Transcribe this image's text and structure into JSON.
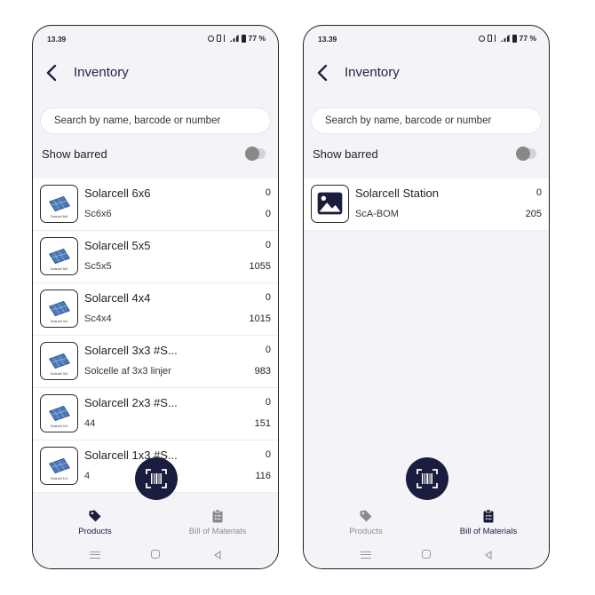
{
  "screens": [
    {
      "status": {
        "time": "13.39",
        "battery": "77 %"
      },
      "header": {
        "title": "Inventory"
      },
      "search": {
        "placeholder": "Search by name, barcode or number"
      },
      "barred": {
        "label": "Show barred",
        "enabled": false
      },
      "items": [
        {
          "name": "Solarcell 6x6",
          "sub": "Sc6x6",
          "top_value": "0",
          "bottom_value": "0",
          "thumb": "solar-panel-icon",
          "thumb_caption": "Solarcell 6x6"
        },
        {
          "name": "Solarcell 5x5",
          "sub": "Sc5x5",
          "top_value": "0",
          "bottom_value": "1055",
          "thumb": "solar-panel-icon",
          "thumb_caption": "Solarcell 5x5"
        },
        {
          "name": "Solarcell 4x4",
          "sub": "Sc4x4",
          "top_value": "0",
          "bottom_value": "1015",
          "thumb": "solar-panel-icon",
          "thumb_caption": "Solarcell 4x4"
        },
        {
          "name": "Solarcell 3x3 #S...",
          "sub": "Solcelle af 3x3 linjer",
          "top_value": "0",
          "bottom_value": "983",
          "thumb": "solar-panel-icon",
          "thumb_caption": "Solarcell 3x3"
        },
        {
          "name": "Solarcell 2x3 #S...",
          "sub": "44",
          "top_value": "0",
          "bottom_value": "151",
          "thumb": "solar-panel-icon",
          "thumb_caption": "Solarcell 2x3"
        },
        {
          "name": "Solarcell 1x3 #S...",
          "sub": "4",
          "top_value": "0",
          "bottom_value": "116",
          "thumb": "solar-panel-icon",
          "thumb_caption": "Solarcell 1x3"
        }
      ],
      "nav": {
        "products": "Products",
        "bom": "Bill of Materials",
        "active": "products"
      }
    },
    {
      "status": {
        "time": "13.39",
        "battery": "77 %"
      },
      "header": {
        "title": "Inventory"
      },
      "search": {
        "placeholder": "Search by name, barcode or number"
      },
      "barred": {
        "label": "Show barred",
        "enabled": false
      },
      "items": [
        {
          "name": "Solarcell Station",
          "sub": "ScA-BOM",
          "top_value": "0",
          "bottom_value": "205",
          "thumb": "image-placeholder-icon"
        }
      ],
      "nav": {
        "products": "Products",
        "bom": "Bill of Materials",
        "active": "bom"
      }
    }
  ],
  "colors": {
    "brand_dark": "#1b1d3e",
    "background": "#f4f4f8",
    "inactive": "#8a8a95"
  }
}
